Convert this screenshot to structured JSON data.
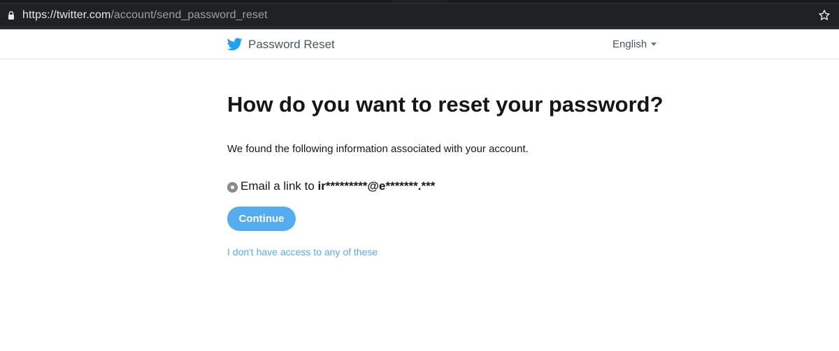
{
  "browser": {
    "url_scheme": "https://",
    "url_host": "twitter.com",
    "url_path": "/account/send_password_reset",
    "lock_icon": "lock-icon",
    "star_icon": "bookmark-star-icon"
  },
  "header": {
    "logo_icon": "twitter-bird-icon",
    "title": "Password Reset",
    "language": "English",
    "brand_color": "#1da1f2"
  },
  "main": {
    "headline": "How do you want to reset your password?",
    "description": "We found the following information associated with your account.",
    "option": {
      "label_prefix": "Email a link to ",
      "email_masked": "ir*********@e*******.***",
      "selected": true
    },
    "continue_label": "Continue",
    "no_access_link": "I don't have access to any of these",
    "accent_color": "#55acee"
  }
}
